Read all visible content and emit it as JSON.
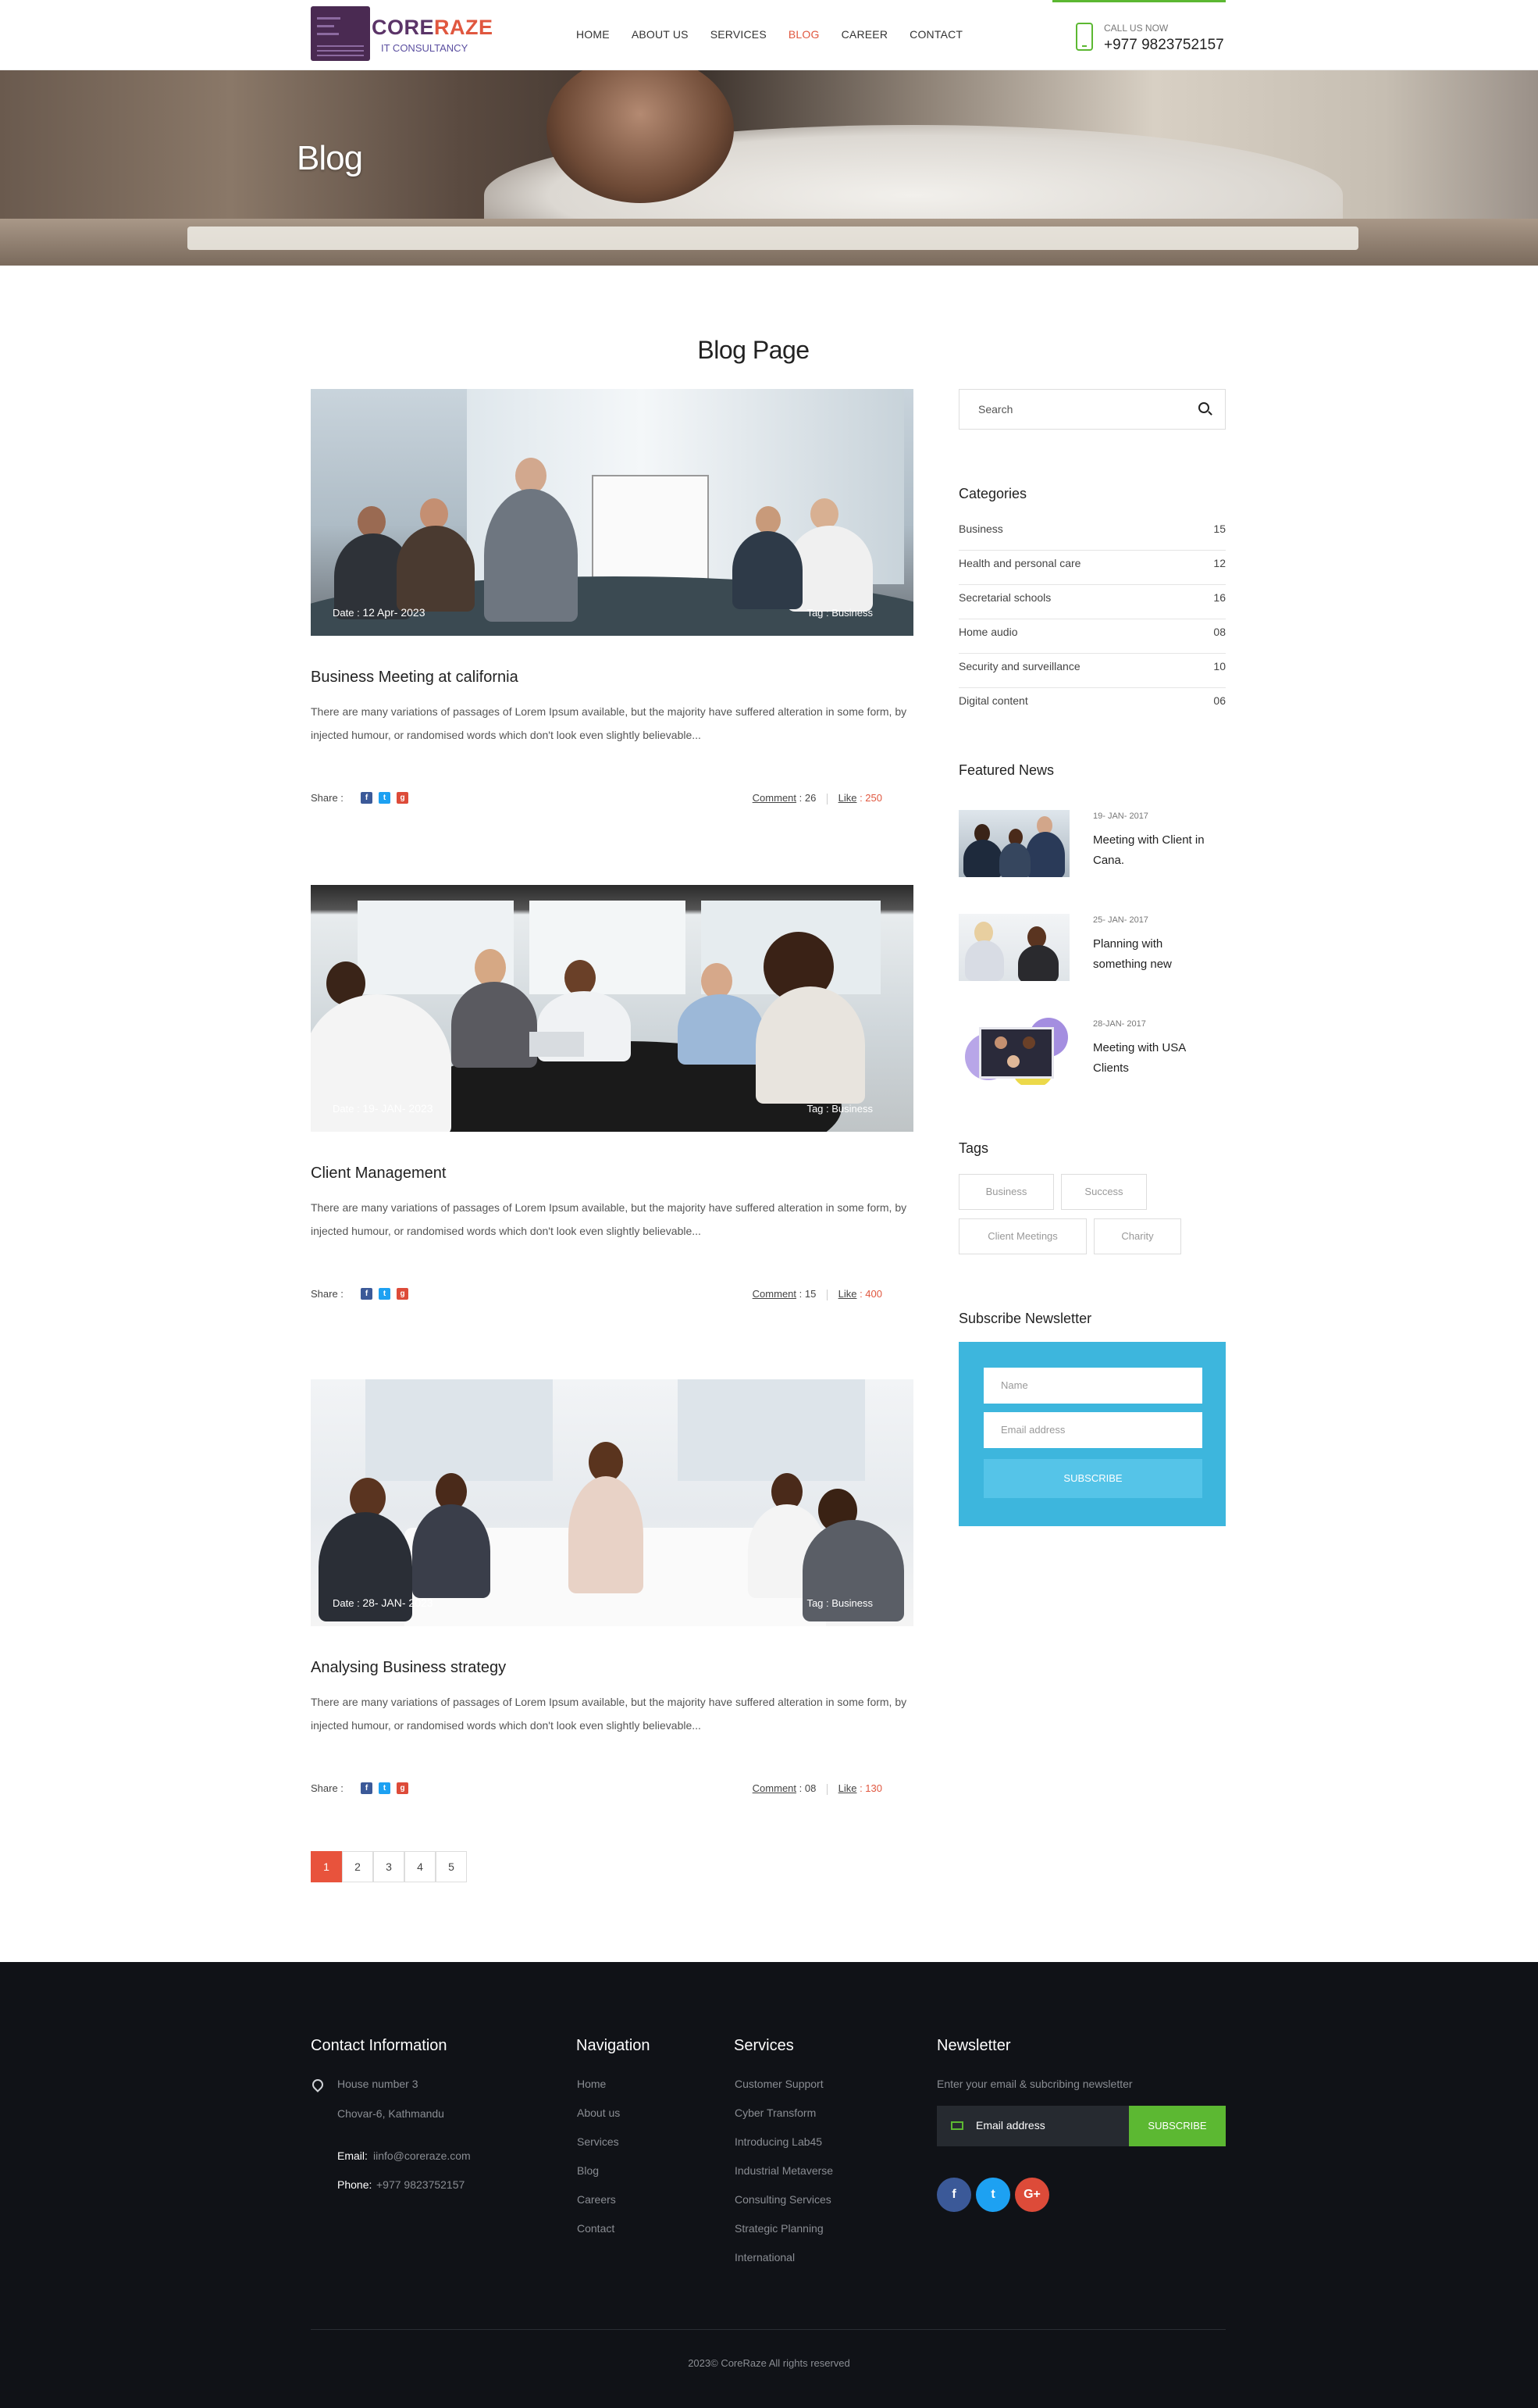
{
  "header": {
    "logo_brand_a": "CORE",
    "logo_brand_b": "RAZE",
    "logo_sub": "IT CONSULTANCY",
    "nav": [
      "HOME",
      "ABOUT US",
      "SERVICES",
      "BLOG",
      "CAREER",
      "CONTACT"
    ],
    "active_nav": "BLOG",
    "call_label": "CALL US NOW",
    "phone": "+977 9823752157"
  },
  "hero": {
    "title": "Blog"
  },
  "page_title": "Blog Page",
  "posts": [
    {
      "date_label": "Date :",
      "date": "12 Apr- 2023",
      "tag_label": "Tag :",
      "tag": "Business",
      "title": "Business Meeting at california",
      "excerpt": "There are many variations of passages of Lorem Ipsum available, but the majority have suffered alteration in some form, by injected humour, or randomised words which don't look even slightly believable...",
      "share": "Share :",
      "comment_label": "Comment",
      "comment_count": ": 26",
      "like_label": "Like",
      "like_count": ": 250"
    },
    {
      "date_label": "Date :",
      "date": "19- JAN- 2023",
      "tag_label": "Tag :",
      "tag": "Business",
      "title": "Client Management",
      "excerpt": "There are many variations of passages of Lorem Ipsum available, but the majority have suffered alteration in some form, by injected humour, or randomised words which don't look even slightly believable...",
      "share": "Share :",
      "comment_label": "Comment",
      "comment_count": ": 15",
      "like_label": "Like",
      "like_count": ": 400"
    },
    {
      "date_label": "Date :",
      "date": "28- JAN- 2023",
      "tag_label": "Tag :",
      "tag": "Business",
      "title": "Analysing Business strategy",
      "excerpt": "There are many variations of passages of Lorem Ipsum available, but the majority have suffered alteration in some form, by injected humour, or randomised words which don't look even slightly believable...",
      "share": "Share :",
      "comment_label": "Comment",
      "comment_count": ": 08",
      "like_label": "Like",
      "like_count": ": 130"
    }
  ],
  "pagination": {
    "pages": [
      "1",
      "2",
      "3",
      "4",
      "5"
    ],
    "current": "1"
  },
  "sidebar": {
    "search_placeholder": "Search",
    "categories_title": "Categories",
    "categories": [
      {
        "name": "Business",
        "count": "15"
      },
      {
        "name": "Health and personal care",
        "count": "12"
      },
      {
        "name": "Secretarial schools",
        "count": "16"
      },
      {
        "name": "Home audio",
        "count": "08"
      },
      {
        "name": "Security and surveillance",
        "count": "10"
      },
      {
        "name": "Digital content",
        "count": "06"
      }
    ],
    "featured_title": "Featured News",
    "featured": [
      {
        "date": "19- JAN- 2017",
        "title": "Meeting with Client in Cana."
      },
      {
        "date": "25- JAN- 2017",
        "title": "Planning with something new"
      },
      {
        "date": "28-JAN- 2017",
        "title": "Meeting with USA Clients"
      }
    ],
    "tags_title": "Tags",
    "tags": [
      "Business",
      "Success",
      "Client Meetings",
      "Charity"
    ],
    "newsletter_title": "Subscribe Newsletter",
    "name_placeholder": "Name",
    "email_placeholder": "Email address",
    "subscribe_label": "SUBSCRIBE"
  },
  "footer": {
    "contact_title": "Contact Information",
    "address1": "House number 3",
    "address2": "Chovar-6, Kathmandu",
    "email_label": "Email:",
    "email": "iinfo@coreraze.com",
    "phone_label": "Phone:",
    "phone": "+977 9823752157",
    "nav_title": "Navigation",
    "nav": [
      "Home",
      "About us",
      "Services",
      "Blog",
      "Careers",
      "Contact"
    ],
    "services_title": "Services",
    "services": [
      "Customer Support",
      "Cyber Transform",
      "Introducing Lab45",
      "Industrial Metaverse",
      "Consulting Services",
      "Strategic Planning",
      "International"
    ],
    "newsletter_title": "Newsletter",
    "newsletter_text": "Enter your email & subcribing newsletter",
    "email_field": "Email address",
    "subscribe_label": "SUBSCRIBE",
    "copyright": "2023© CoreRaze All rights reserved"
  },
  "colors": {
    "accent": "#e8533c",
    "green": "#5cb832",
    "newsletter_blue": "#3db6dd",
    "footer_bg": "#101217"
  }
}
